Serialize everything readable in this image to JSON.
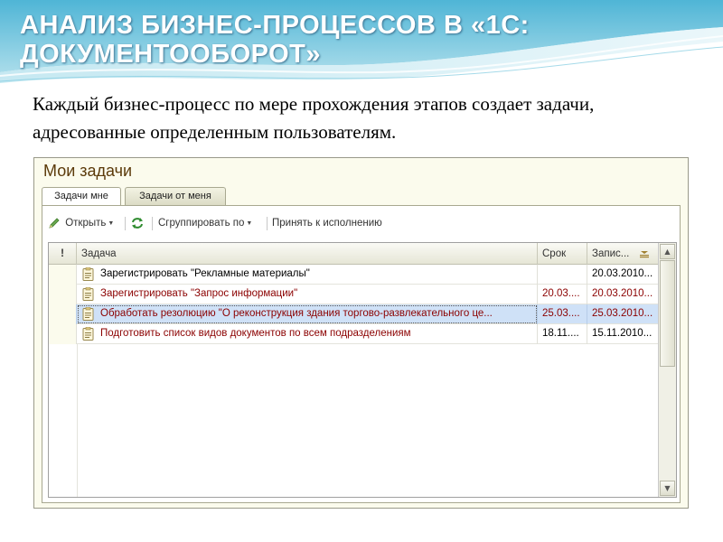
{
  "slide": {
    "title": "АНАЛИЗ БИЗНЕС-ПРОЦЕССОВ В «1С: ДОКУМЕНТООБОРОТ»",
    "text": "Каждый бизнес-процесс по мере прохождения этапов создает задачи, адресованные определенным пользователям."
  },
  "window": {
    "title": "Мои задачи",
    "tabs": [
      {
        "label": "Задачи мне",
        "active": true
      },
      {
        "label": "Задачи от меня",
        "active": false
      }
    ],
    "toolbar": {
      "open_label": "Открыть",
      "group_label": "Сгруппировать по",
      "accept_label": "Принять к исполнению"
    },
    "columns": {
      "importance": "!",
      "task": "Задача",
      "deadline": "Срок",
      "created": "Запис..."
    },
    "rows": [
      {
        "task": "Зарегистрировать \"Рекламные материалы\"",
        "deadline": "",
        "created": "20.03.2010...",
        "overdue": false,
        "selected": false
      },
      {
        "task": "Зарегистрировать \"Запрос информации\"",
        "deadline": "20.03....",
        "created": "20.03.2010...",
        "overdue": true,
        "selected": false
      },
      {
        "task": "Обработать резолюцию \"О реконструкция здания торгово-развлекательного це...",
        "deadline": "25.03....",
        "created": "25.03.2010...",
        "overdue": true,
        "selected": true
      },
      {
        "task": "Подготовить список видов документов по всем подразделениям",
        "deadline": "18.11....",
        "created": "15.11.2010...",
        "overdue": true,
        "selected": false
      }
    ]
  },
  "colors": {
    "overdue_text": "#8b0000",
    "normal_text": "#000000",
    "selection": "#cfe1f7",
    "window_bg": "#fbfbed",
    "title_color": "#5b3a0a"
  },
  "icons": {
    "open": "pencil-icon",
    "refresh": "refresh-icon",
    "task": "task-document-icon",
    "sort": "sort-descending-icon"
  }
}
